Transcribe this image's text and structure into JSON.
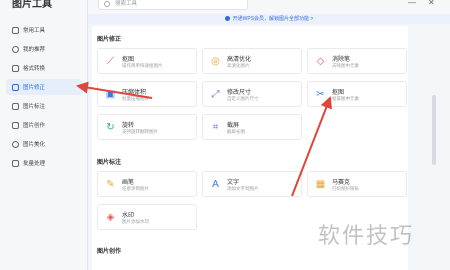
{
  "app": {
    "title": "图片工具"
  },
  "topbar": {
    "search_placeholder": "搜索工具",
    "minimize": "—",
    "close": "✕"
  },
  "notice": {
    "text": "开通WPS会员，解锁图片全部功能 >"
  },
  "sidebar": {
    "items": [
      {
        "label": "常用工具",
        "active": false
      },
      {
        "label": "我的推荐",
        "active": false
      },
      {
        "label": "格式转换",
        "active": false
      },
      {
        "label": "图片修正",
        "active": true
      },
      {
        "label": "图片标注",
        "active": false
      },
      {
        "label": "图片创作",
        "active": false
      },
      {
        "label": "图片美化",
        "active": false
      },
      {
        "label": "批量处理",
        "active": false
      }
    ]
  },
  "sections": [
    {
      "title": "图片修正",
      "cards": [
        {
          "name": "抠图",
          "desc": "操作简单快速抠图片",
          "icon": "crop-icon",
          "color": "#e05a4f"
        },
        {
          "name": "高清优化",
          "desc": "高清化图片",
          "icon": "hd-icon",
          "color": "#e5a42b"
        },
        {
          "name": "消除笔",
          "desc": "去除图中元素",
          "icon": "eraser-icon",
          "color": "#e05a4f"
        },
        {
          "name": "压缩体积",
          "desc": "批量压缩图片",
          "icon": "compress-icon",
          "color": "#3b78e7"
        },
        {
          "name": "修改尺寸",
          "desc": "自定义图片尺寸",
          "icon": "resize-icon",
          "color": "#8a5fd6"
        },
        {
          "name": "抠图",
          "desc": "抠取图中元素",
          "icon": "cutout-icon",
          "color": "#3b78e7"
        },
        {
          "name": "旋转",
          "desc": "支持旋转翻转图片",
          "icon": "rotate-icon",
          "color": "#2ba99a"
        },
        {
          "name": "截屏",
          "desc": "截取长图",
          "icon": "screenshot-icon",
          "color": "#8a5fd6"
        }
      ]
    },
    {
      "title": "图片标注",
      "cards": [
        {
          "name": "画笔",
          "desc": "任意涂鸦图片",
          "icon": "brush-icon",
          "color": "#e5a42b"
        },
        {
          "name": "文字",
          "desc": "添加文字到图片",
          "icon": "text-icon",
          "color": "#3b78e7"
        },
        {
          "name": "马赛克",
          "desc": "打码保护隐私",
          "icon": "mosaic-icon",
          "color": "#e5a42b"
        },
        {
          "name": "水印",
          "desc": "图片添加水印",
          "icon": "watermark-icon",
          "color": "#e05a4f"
        }
      ]
    },
    {
      "title": "图片创作",
      "cards": []
    }
  ],
  "watermark": {
    "text": "软件技巧"
  },
  "colors": {
    "accent": "#2a6be0",
    "arrow": "#e0443a"
  }
}
